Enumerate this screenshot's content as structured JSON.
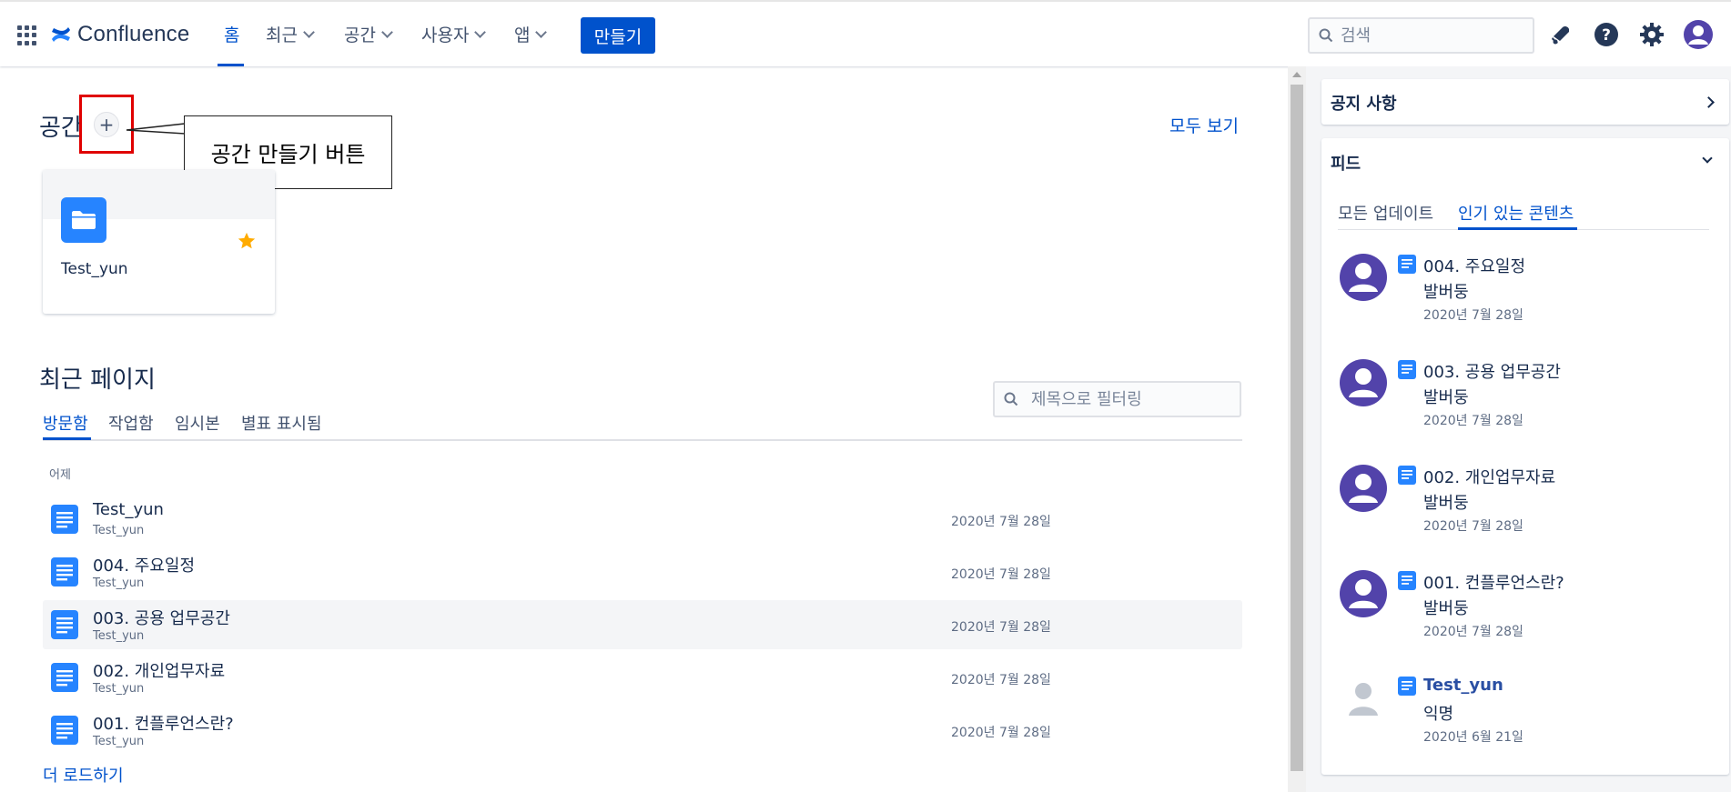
{
  "nav": {
    "logo": "Confluence",
    "home": "홈",
    "recent": "최근",
    "spaces": "공간",
    "people": "사용자",
    "apps": "앱",
    "create": "만들기",
    "search_placeholder": "검색"
  },
  "spaces_section": {
    "title": "공간",
    "add_symbol": "+",
    "callout": "공간 만들기 버튼",
    "view_all": "모두 보기",
    "cards": [
      {
        "name": "Test_yun",
        "starred": true
      }
    ]
  },
  "recent_pages": {
    "title": "최근 페이지",
    "tabs": [
      "방문함",
      "작업함",
      "임시본",
      "별표 표시됨"
    ],
    "active_tab": "방문함",
    "filter_placeholder": "제목으로 필터링",
    "group_label": "어제",
    "rows": [
      {
        "title": "Test_yun",
        "space": "Test_yun",
        "date": "2020년 7월 28일"
      },
      {
        "title": "004. 주요일정",
        "space": "Test_yun",
        "date": "2020년 7월 28일"
      },
      {
        "title": "003. 공용 업무공간",
        "space": "Test_yun",
        "date": "2020년 7월 28일"
      },
      {
        "title": "002. 개인업무자료",
        "space": "Test_yun",
        "date": "2020년 7월 28일"
      },
      {
        "title": "001. 컨플루언스란?",
        "space": "Test_yun",
        "date": "2020년 7월 28일"
      }
    ],
    "load_more": "더 로드하기"
  },
  "right_panel": {
    "announcements": "공지 사항",
    "feed_title": "피드",
    "feed_tabs": [
      "모든 업데이트",
      "인기 있는 콘텐츠"
    ],
    "active_feed_tab": "인기 있는 콘텐츠",
    "feed": [
      {
        "title": "004. 주요일정",
        "author": "발버둥",
        "date": "2020년 7월 28일"
      },
      {
        "title": "003. 공용 업무공간",
        "author": "발버둥",
        "date": "2020년 7월 28일"
      },
      {
        "title": "002. 개인업무자료",
        "author": "발버둥",
        "date": "2020년 7월 28일"
      },
      {
        "title": "001. 컨플루언스란?",
        "author": "발버둥",
        "date": "2020년 7월 28일"
      },
      {
        "title": "Test_yun",
        "author": "익명",
        "date": "2020년 6월 21일"
      }
    ]
  },
  "colors": {
    "brand": "#0052cc",
    "annotation": "#e00000",
    "avatar": "#5243aa"
  },
  "icons": [
    "app-switcher-icon",
    "confluence-logo-icon",
    "search-icon",
    "notification-icon",
    "help-icon",
    "settings-icon",
    "avatar-icon",
    "folder-icon",
    "star-icon",
    "page-icon"
  ]
}
